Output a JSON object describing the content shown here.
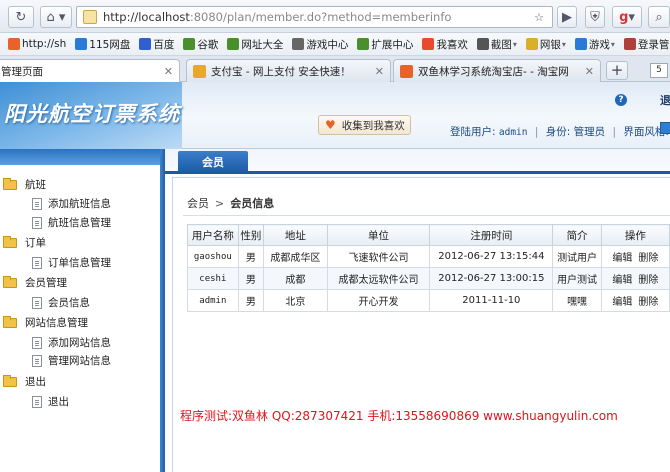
{
  "browser": {
    "url_host": "http://localhost",
    "url_rest": ":8080/plan/member.do?method=memberinfo",
    "bookmarks": [
      {
        "label": "http://sh",
        "color": "#e8622a"
      },
      {
        "label": "115网盘",
        "color": "#2a7ad8"
      },
      {
        "label": "百度",
        "color": "#3060d0"
      },
      {
        "label": "谷歌",
        "color": "#4a8f2e"
      },
      {
        "label": "网址大全",
        "color": "#4a8f2e"
      },
      {
        "label": "游戏中心",
        "color": "#666666"
      },
      {
        "label": "扩展中心",
        "color": "#4a8f2e"
      },
      {
        "label": "我喜欢",
        "color": "#e84a2e"
      },
      {
        "label": "截图",
        "color": "#555555"
      },
      {
        "label": "网银",
        "color": "#d8b02a"
      },
      {
        "label": "游戏",
        "color": "#2a7ad8"
      },
      {
        "label": "登录管",
        "color": "#b0403a"
      }
    ],
    "tabs": [
      {
        "label": "管理页面",
        "active": true,
        "color": "#2a7ad8"
      },
      {
        "label": "支付宝 - 网上支付 安全快速！",
        "active": false,
        "color": "#e8a82a"
      },
      {
        "label": "双鱼林学习系统淘宝店- - 淘宝网",
        "active": false,
        "color": "#e8622a"
      }
    ],
    "tab_count": "5"
  },
  "header": {
    "logo_text": "阳光航空订票系统",
    "favorite_label": "收集到我喜欢",
    "logout": "退",
    "login_user_label": "登陆用户:",
    "login_user": "admin",
    "role_label": "身份:",
    "role": "管理员",
    "theme_label": "界面风格:"
  },
  "sidebar": {
    "groups": [
      {
        "label": "航班",
        "items": [
          "添加航班信息",
          "航班信息管理"
        ]
      },
      {
        "label": "订单",
        "items": [
          "订单信息管理"
        ]
      },
      {
        "label": "会员管理",
        "items": [
          "会员信息"
        ]
      },
      {
        "label": "网站信息管理",
        "items": [
          "添加网站信息",
          "管理网站信息"
        ]
      },
      {
        "label": "退出",
        "items": [
          "退出"
        ]
      }
    ]
  },
  "main": {
    "tab_label": "会员",
    "breadcrumb": [
      "会员",
      "会员信息"
    ],
    "table": {
      "headers": [
        "用户名称",
        "性别",
        "地址",
        "单位",
        "注册时间",
        "简介",
        "操作"
      ],
      "rows": [
        {
          "username": "gaoshou",
          "gender": "男",
          "address": "成都成华区",
          "company": "飞速软件公司",
          "time": "2012-06-27 13:15:44",
          "intro": "测试用户",
          "edit": "编辑",
          "delete": "删除"
        },
        {
          "username": "ceshi",
          "gender": "男",
          "address": "成都",
          "company": "成都太远软件公司",
          "time": "2012-06-27 13:00:15",
          "intro": "用户测试",
          "edit": "编辑",
          "delete": "删除"
        },
        {
          "username": "admin",
          "gender": "男",
          "address": "北京",
          "company": "开心开发",
          "time": "2011-11-10",
          "intro": "嘿嘿",
          "edit": "编辑",
          "delete": "删除"
        }
      ]
    },
    "credit": "程序测试:双鱼林 QQ:287307421 手机:13558690869 www.shuangyulin.com"
  }
}
